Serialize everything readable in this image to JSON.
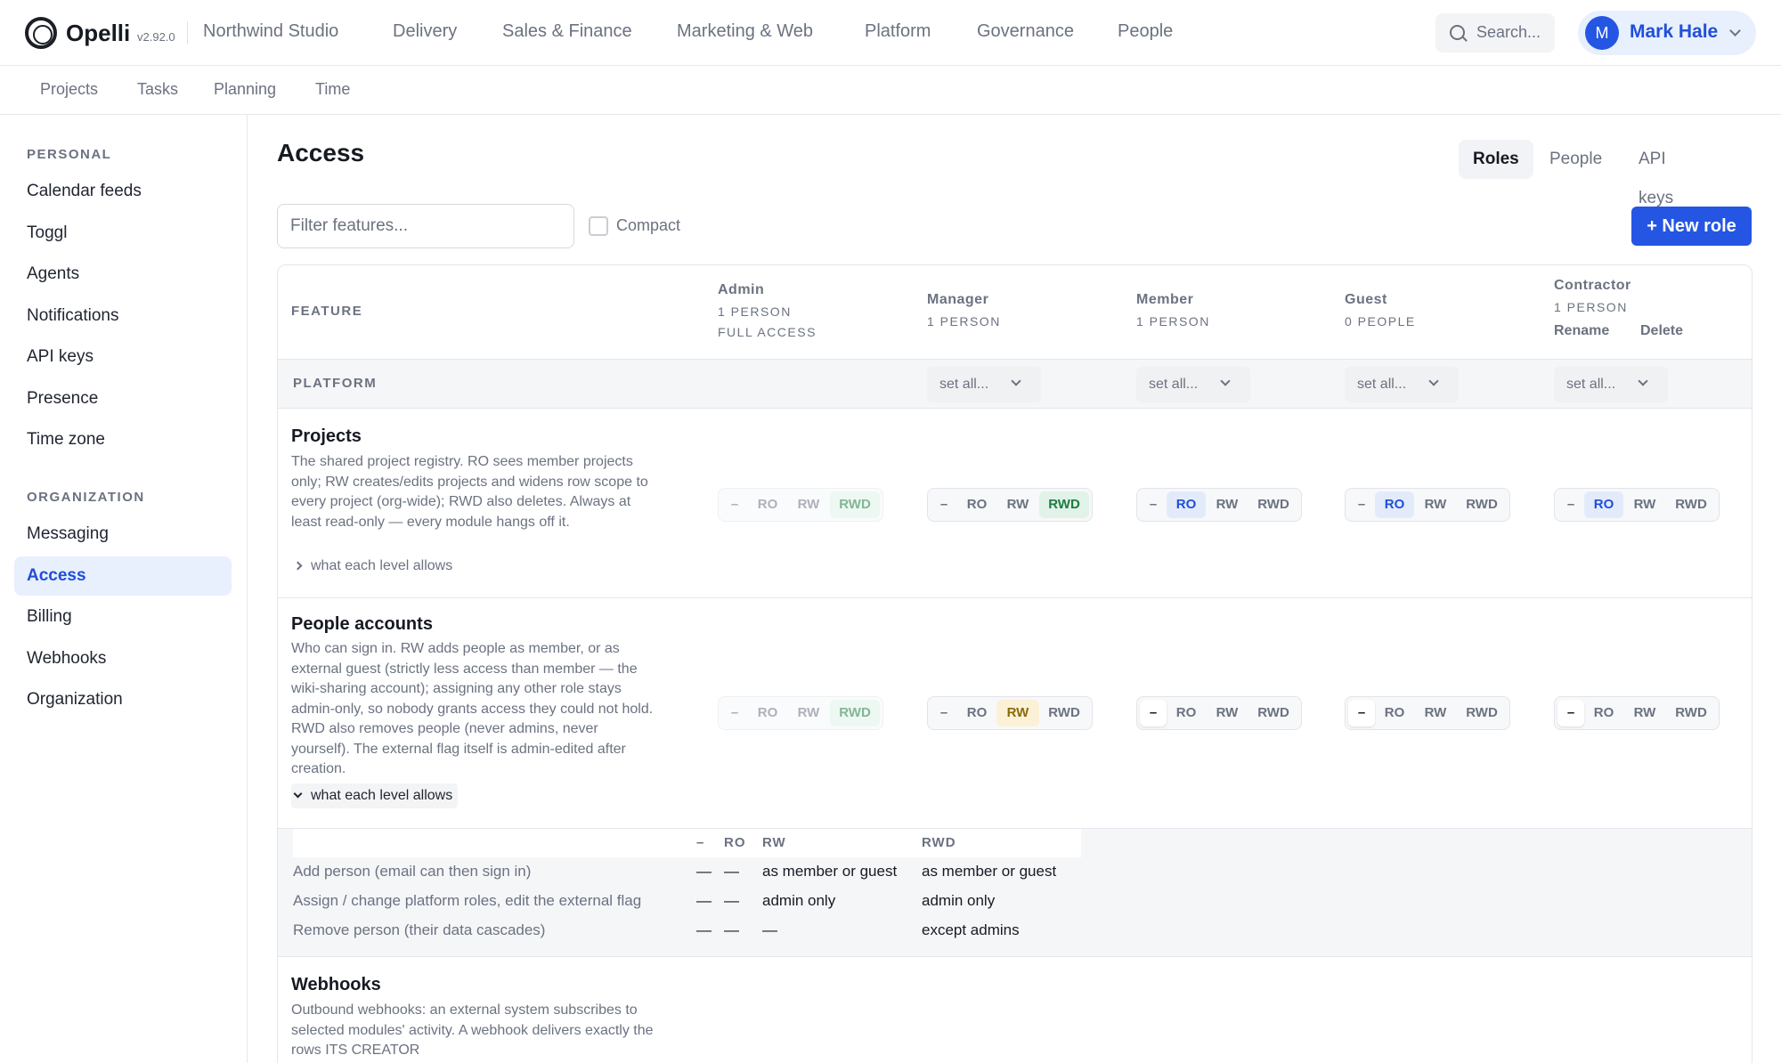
{
  "app": {
    "brand": "Opelli",
    "version": "v2.92.0",
    "workspace": "Northwind Studio",
    "nav": [
      "Delivery",
      "Sales & Finance",
      "Marketing & Web",
      "Platform",
      "Governance",
      "People"
    ],
    "search_placeholder": "Search...",
    "user": {
      "initial": "M",
      "name": "Mark Hale"
    }
  },
  "subnav": [
    "Projects",
    "Tasks",
    "Planning",
    "Time"
  ],
  "sidebar": {
    "personal_heading": "PERSONAL",
    "personal_items": [
      "Calendar feeds",
      "Toggl",
      "Agents",
      "Notifications",
      "API keys",
      "Presence",
      "Time zone"
    ],
    "org_heading": "ORGANIZATION",
    "org_items": [
      "Messaging",
      "Access",
      "Billing",
      "Webhooks",
      "Organization"
    ],
    "active": "Access"
  },
  "page": {
    "title": "Access",
    "tabs": [
      "Roles",
      "People",
      "API keys"
    ],
    "active_tab": "Roles",
    "filter_placeholder": "Filter features...",
    "compact_label": "Compact",
    "compact_checked": false,
    "new_role_label": "+ New role"
  },
  "table": {
    "feature_header": "FEATURE",
    "roles": [
      {
        "name": "Admin",
        "count": "1 PERSON",
        "note": "FULL ACCESS"
      },
      {
        "name": "Manager",
        "count": "1 PERSON"
      },
      {
        "name": "Member",
        "count": "1 PERSON"
      },
      {
        "name": "Guest",
        "count": "0 PEOPLE"
      },
      {
        "name": "Contractor",
        "count": "1 PERSON",
        "actions": [
          "Rename",
          "Delete"
        ]
      }
    ],
    "group": {
      "name": "PLATFORM",
      "set_all_label": "set all..."
    },
    "level_labels": [
      "–",
      "RO",
      "RW",
      "RWD"
    ],
    "features": [
      {
        "title": "Projects",
        "description": "The shared project registry. RO sees member projects only; RW creates/edits projects and widens row scope to every project (org-wide); RWD also deletes. Always at least read-only — every module hangs off it.",
        "toggle": "what each level allows",
        "expanded": false,
        "levels": [
          "RWD",
          "RWD",
          "RO",
          "RO",
          "RO"
        ]
      },
      {
        "title": "People accounts",
        "description": "Who can sign in. RW adds people as member, or as external guest (strictly less access than member — the wiki-sharing account); assigning any other role stays admin-only, so nobody grants access they could not hold. RWD also removes people (never admins, never yourself). The external flag itself is admin-edited after creation.",
        "toggle": "what each level allows",
        "expanded": true,
        "levels": [
          "RWD",
          "RW",
          "–",
          "–",
          "–"
        ],
        "details": {
          "columns": [
            "–",
            "RO",
            "RW",
            "RWD"
          ],
          "rows": [
            {
              "label": "Add person (email can then sign in)",
              "cells": [
                "—",
                "—",
                "as member or guest",
                "as member or guest"
              ]
            },
            {
              "label": "Assign / change platform roles, edit the external flag",
              "cells": [
                "—",
                "—",
                "admin only",
                "admin only"
              ]
            },
            {
              "label": "Remove person (their data cascades)",
              "cells": [
                "—",
                "—",
                "—",
                "except admins"
              ]
            }
          ]
        }
      },
      {
        "title": "Webhooks",
        "description": "Outbound webhooks: an external system subscribes to selected modules' activity. A webhook delivers exactly the rows ITS CREATOR"
      }
    ]
  },
  "colors": {
    "accent": "#2456e3",
    "ro": "#1f4fd8",
    "rw": "#8a6a0b",
    "rwd": "#1f7a44"
  }
}
